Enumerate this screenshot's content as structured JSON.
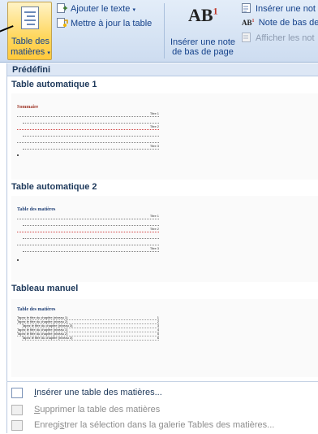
{
  "ribbon": {
    "toc_button": {
      "label_line1": "Table des",
      "label_line2": "matières",
      "caret": "▾"
    },
    "add_text": {
      "label": "Ajouter le texte",
      "caret": "▾"
    },
    "update_table": {
      "label": "Mettre à jour la table"
    },
    "insert_footnote": {
      "icon_text": "AB",
      "icon_sup": "1",
      "label_line1": "Insérer une note",
      "label_line2": "de bas de page"
    },
    "insert_endnote": {
      "label": "Insérer une not"
    },
    "next_footnote": {
      "icon_text": "AB",
      "icon_sup": "1",
      "label": "Note de bas de"
    },
    "show_notes": {
      "label": "Afficher les not"
    }
  },
  "gallery": {
    "header": "Prédéfini",
    "sections": [
      {
        "title": "Table automatique 1",
        "preview_title": "Sommaire",
        "entries": [
          "Titre 1",
          "Titre 2",
          "Titre 3"
        ]
      },
      {
        "title": "Table automatique 2",
        "preview_title": "Table des matières",
        "entries": [
          "Titre 1",
          "Titre 2",
          "Titre 3"
        ]
      },
      {
        "title": "Tableau manuel",
        "preview_title": "Table des matières",
        "lines": [
          {
            "text": "Tapez le titre du chapitre (niveau 1)",
            "num": "1"
          },
          {
            "text": "Tapez le titre du chapitre (niveau 2)",
            "num": "2"
          },
          {
            "text": "Tapez le titre du chapitre (niveau 3)",
            "num": "3"
          },
          {
            "text": "Tapez le titre du chapitre (niveau 1)",
            "num": "4"
          },
          {
            "text": "Tapez le titre du chapitre (niveau 2)",
            "num": "5"
          },
          {
            "text": "Tapez le titre du chapitre (niveau 3)",
            "num": "6"
          }
        ]
      }
    ]
  },
  "menu": {
    "insert_toc": {
      "accel": "I",
      "rest": "nsérer une table des matières..."
    },
    "remove_toc": {
      "accel": "S",
      "rest": "upprimer la table des matières"
    },
    "save_selection": {
      "pre": "Enregi",
      "accel": "s",
      "rest": "trer la sélection dans la galerie Tables des matières..."
    }
  },
  "colors": {
    "ribbon_bg": "#dbe6f5",
    "active_button": "#ffd75e",
    "text_primary": "#15428b",
    "heading_blue": "#1f3f75",
    "disabled_text": "#8d8d8d"
  }
}
